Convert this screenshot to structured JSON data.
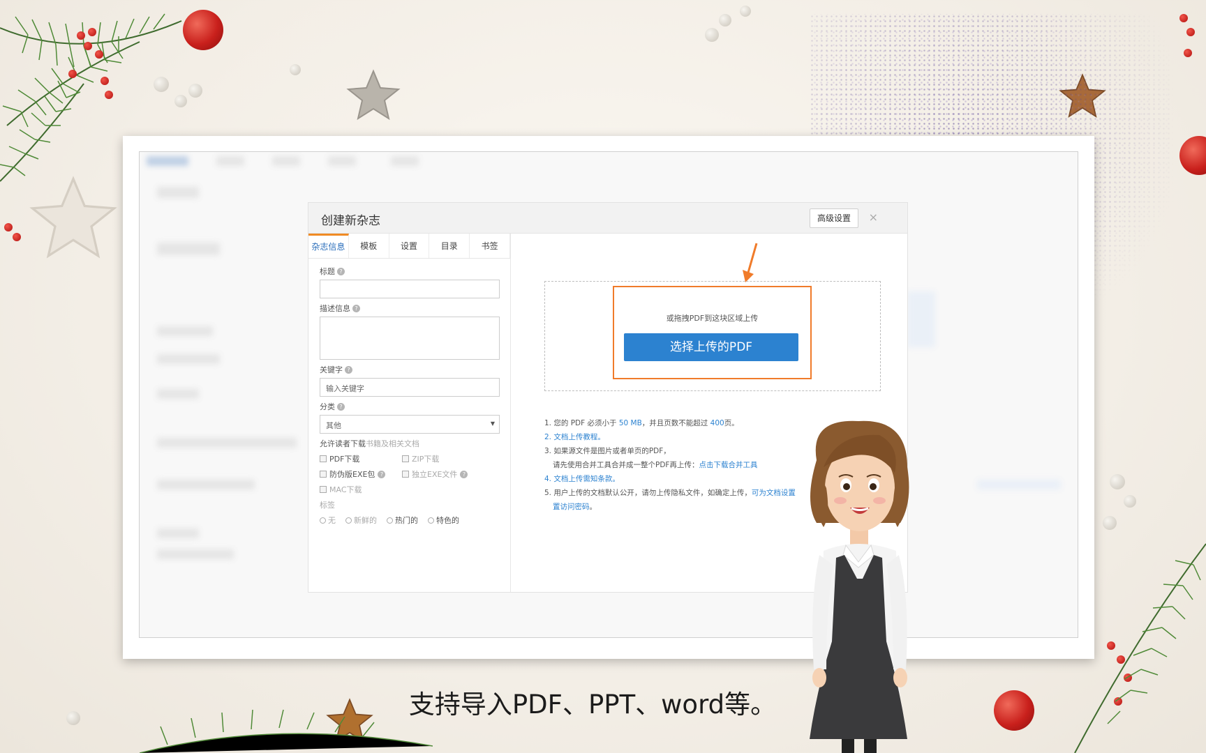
{
  "dialog": {
    "title": "创建新杂志",
    "advanced_button": "高级设置",
    "close": "×"
  },
  "tabs": [
    {
      "label": "杂志信息",
      "active": true
    },
    {
      "label": "模板",
      "active": false
    },
    {
      "label": "设置",
      "active": false
    },
    {
      "label": "目录",
      "active": false
    },
    {
      "label": "书签",
      "active": false
    }
  ],
  "form": {
    "title_label": "标题",
    "description_label": "描述信息",
    "keywords_label": "关键字",
    "keywords_placeholder": "输入关键字",
    "category_label": "分类",
    "category_value": "其他",
    "permissions_label": "允许读者下载",
    "permissions_faint": "书籍及相关文档",
    "options": {
      "pdf_download": "PDF下载",
      "zip_download": "ZIP下载",
      "anti_exe": "防伪版EXE包",
      "standalone_exe": "独立EXE文件",
      "mac_download": "MAC下载"
    },
    "tag_label": "标签",
    "tags": [
      "无",
      "新鲜的",
      "热门的",
      "特色的"
    ]
  },
  "upload": {
    "drop_hint": "或拖拽PDF到这块区域上传",
    "button_label": "选择上传的PDF",
    "accent_color": "#2c82d0",
    "highlight_color": "#f07b2a"
  },
  "notes": {
    "n1_pre": "1. 您的 PDF 必须小于 ",
    "n1_size": "50 MB",
    "n1_mid": "，并且页数不能超过 ",
    "n1_pages": "400",
    "n1_post": "页。",
    "n2": "2. 文档上传教程。",
    "n3a": "3. 如果源文件是图片或者单页的PDF，",
    "n3b_pre": "请先使用合并工具合并成一整个PDF再上传：",
    "n3b_link": "点击下载合并工具",
    "n4": "4. 文档上传需知条款。",
    "n5_pre": "5. 用户上传的文档默认公开，请勿上传隐私文件，如确定上传，",
    "n5_link": "可为文档设置",
    "n5_link2": "置访问密码",
    "n5_post": "。"
  },
  "subtitle": "支持导入PDF、PPT、word等。"
}
